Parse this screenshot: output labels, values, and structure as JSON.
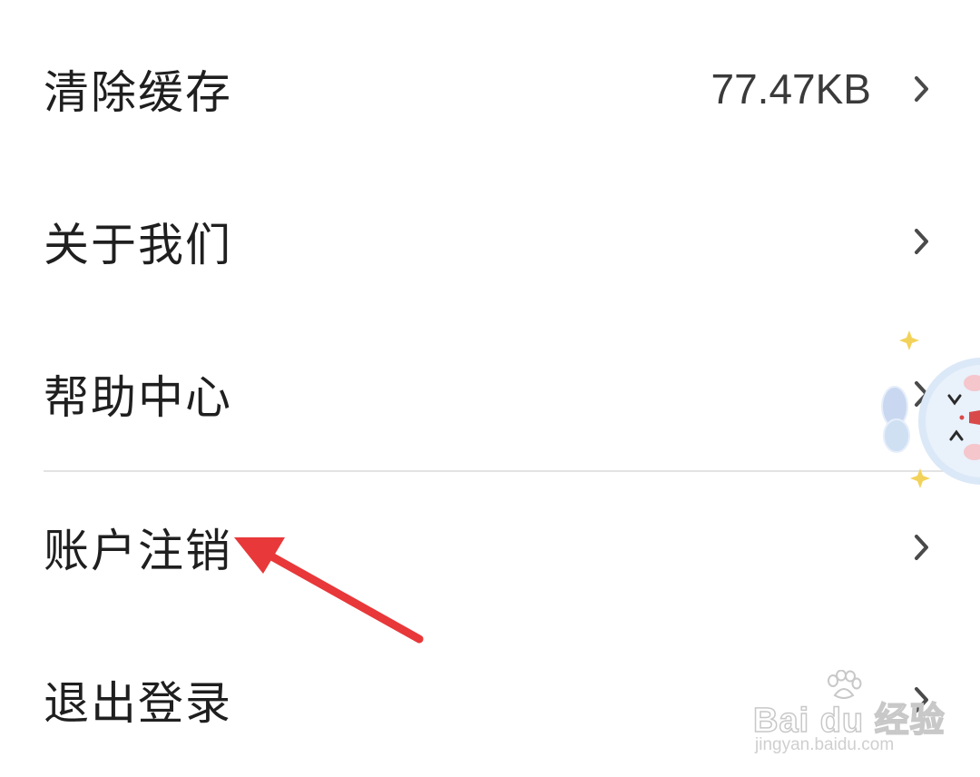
{
  "settings": {
    "items": [
      {
        "label": "清除缓存",
        "value": "77.47KB"
      },
      {
        "label": "关于我们"
      },
      {
        "label": "帮助中心"
      },
      {
        "label": "账户注销"
      },
      {
        "label": "退出登录"
      }
    ]
  },
  "watermark": {
    "brand": "Bai du 经验",
    "url": "jingyan.baidu.com"
  },
  "colors": {
    "text": "#1f1f1f",
    "secondary_text": "#3a3a3a",
    "chevron": "#4a4a4a",
    "divider": "#e3e3e3",
    "annotation_arrow": "#e8383a"
  },
  "icons": {
    "chevron": "chevron-right-icon",
    "annotation": "red-arrow-annotation",
    "mascot": "floating-mascot-icon",
    "paw": "baidu-paw-icon"
  }
}
